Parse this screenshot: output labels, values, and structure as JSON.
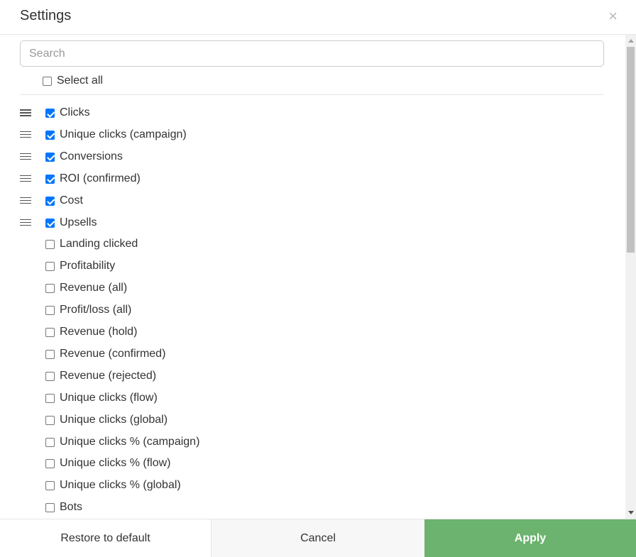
{
  "header": {
    "title": "Settings",
    "close_glyph": "×"
  },
  "search": {
    "placeholder": "Search",
    "value": ""
  },
  "select_all": {
    "label": "Select all",
    "checked": false
  },
  "items": [
    {
      "label": "Clicks",
      "checked": true,
      "draggable": true
    },
    {
      "label": "Unique clicks (campaign)",
      "checked": true,
      "draggable": true
    },
    {
      "label": "Conversions",
      "checked": true,
      "draggable": true
    },
    {
      "label": "ROI (confirmed)",
      "checked": true,
      "draggable": true
    },
    {
      "label": "Cost",
      "checked": true,
      "draggable": true
    },
    {
      "label": "Upsells",
      "checked": true,
      "draggable": true
    },
    {
      "label": "Landing clicked",
      "checked": false,
      "draggable": false
    },
    {
      "label": "Profitability",
      "checked": false,
      "draggable": false
    },
    {
      "label": "Revenue (all)",
      "checked": false,
      "draggable": false
    },
    {
      "label": "Profit/loss (all)",
      "checked": false,
      "draggable": false
    },
    {
      "label": "Revenue (hold)",
      "checked": false,
      "draggable": false
    },
    {
      "label": "Revenue (confirmed)",
      "checked": false,
      "draggable": false
    },
    {
      "label": "Revenue (rejected)",
      "checked": false,
      "draggable": false
    },
    {
      "label": "Unique clicks (flow)",
      "checked": false,
      "draggable": false
    },
    {
      "label": "Unique clicks (global)",
      "checked": false,
      "draggable": false
    },
    {
      "label": "Unique clicks % (campaign)",
      "checked": false,
      "draggable": false
    },
    {
      "label": "Unique clicks % (flow)",
      "checked": false,
      "draggable": false
    },
    {
      "label": "Unique clicks % (global)",
      "checked": false,
      "draggable": false
    },
    {
      "label": "Bots",
      "checked": false,
      "draggable": false
    }
  ],
  "footer": {
    "restore_label": "Restore to default",
    "cancel_label": "Cancel",
    "apply_label": "Apply"
  },
  "colors": {
    "apply_bg": "#6bb36e",
    "checkbox_checked": "#0075ff"
  }
}
